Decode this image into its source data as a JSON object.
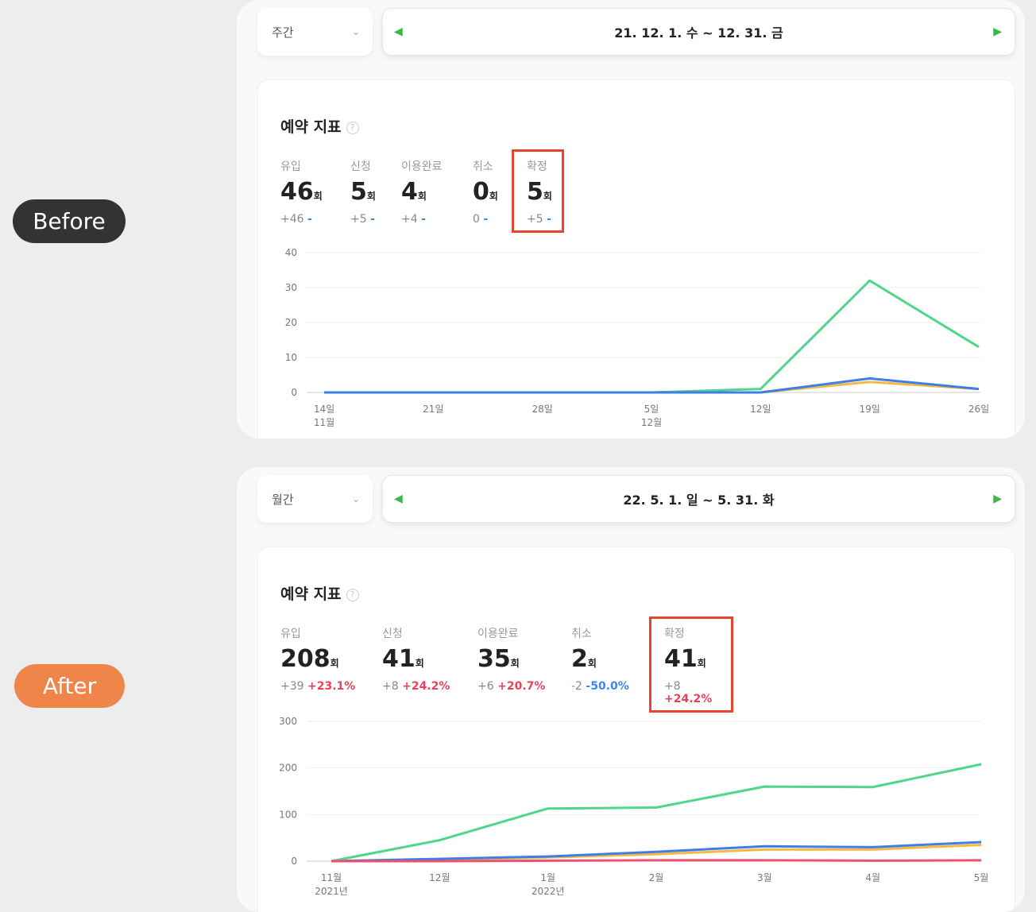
{
  "badges": {
    "before": "Before",
    "after": "After"
  },
  "before": {
    "period": "주간",
    "range": "21. 12. 1. 수  ~  12. 31. 금",
    "title": "예약 지표",
    "help": "?",
    "metrics": [
      {
        "label": "유입",
        "value": "46",
        "unit": "회",
        "delta": "+46",
        "pct": "-",
        "trend": "dn"
      },
      {
        "label": "신청",
        "value": "5",
        "unit": "회",
        "delta": "+5",
        "pct": "-",
        "trend": "dn"
      },
      {
        "label": "이용완료",
        "value": "4",
        "unit": "회",
        "delta": "+4",
        "pct": "-",
        "trend": "dn"
      },
      {
        "label": "취소",
        "value": "0",
        "unit": "회",
        "delta": "0",
        "pct": "-",
        "trend": "dn"
      },
      {
        "label": "확정",
        "value": "5",
        "unit": "회",
        "delta": "+5",
        "pct": "-",
        "trend": "dn",
        "highlight": true
      }
    ]
  },
  "after": {
    "period": "월간",
    "range": "22. 5. 1. 일  ~  5. 31. 화",
    "title": "예약 지표",
    "help": "?",
    "metrics": [
      {
        "label": "유입",
        "value": "208",
        "unit": "회",
        "delta": "+39",
        "pct": "+23.1%",
        "trend": "up"
      },
      {
        "label": "신청",
        "value": "41",
        "unit": "회",
        "delta": "+8",
        "pct": "+24.2%",
        "trend": "up"
      },
      {
        "label": "이용완료",
        "value": "35",
        "unit": "회",
        "delta": "+6",
        "pct": "+20.7%",
        "trend": "up"
      },
      {
        "label": "취소",
        "value": "2",
        "unit": "회",
        "delta": "-2",
        "pct": "-50.0%",
        "trend": "dn"
      },
      {
        "label": "확정",
        "value": "41",
        "unit": "회",
        "delta": "+8",
        "pct": "+24.2%",
        "trend": "up",
        "highlight": true
      }
    ]
  },
  "chart_data": [
    {
      "type": "line",
      "ylim": [
        0,
        40
      ],
      "yticks": [
        0,
        10,
        20,
        30,
        40
      ],
      "categories": [
        "14일\n11월",
        "21일",
        "28일",
        "5일\n12월",
        "12일",
        "19일",
        "26일"
      ],
      "series": [
        {
          "name": "유입",
          "color": "#4fd68a",
          "values": [
            0,
            0,
            0,
            0,
            1,
            32,
            13
          ]
        },
        {
          "name": "이용완료",
          "color": "#f5b942",
          "values": [
            0,
            0,
            0,
            0,
            0,
            3,
            1
          ]
        },
        {
          "name": "신청",
          "color": "#3d7fe8",
          "values": [
            0,
            0,
            0,
            0,
            0,
            4,
            1
          ]
        }
      ]
    },
    {
      "type": "line",
      "ylim": [
        0,
        300
      ],
      "yticks": [
        0,
        100,
        200,
        300
      ],
      "categories": [
        "11월\n2021년",
        "12월",
        "1월\n2022년",
        "2월",
        "3월",
        "4월",
        "5월"
      ],
      "series": [
        {
          "name": "유입",
          "color": "#4fd68a",
          "values": [
            0,
            45,
            113,
            115,
            160,
            159,
            208
          ]
        },
        {
          "name": "이용완료",
          "color": "#f5b942",
          "values": [
            0,
            3,
            8,
            15,
            25,
            25,
            35
          ]
        },
        {
          "name": "신청",
          "color": "#3d7fe8",
          "values": [
            0,
            5,
            10,
            20,
            32,
            30,
            41
          ]
        },
        {
          "name": "취소",
          "color": "#f0506e",
          "values": [
            0,
            0,
            1,
            2,
            2,
            1,
            2
          ]
        }
      ]
    }
  ]
}
